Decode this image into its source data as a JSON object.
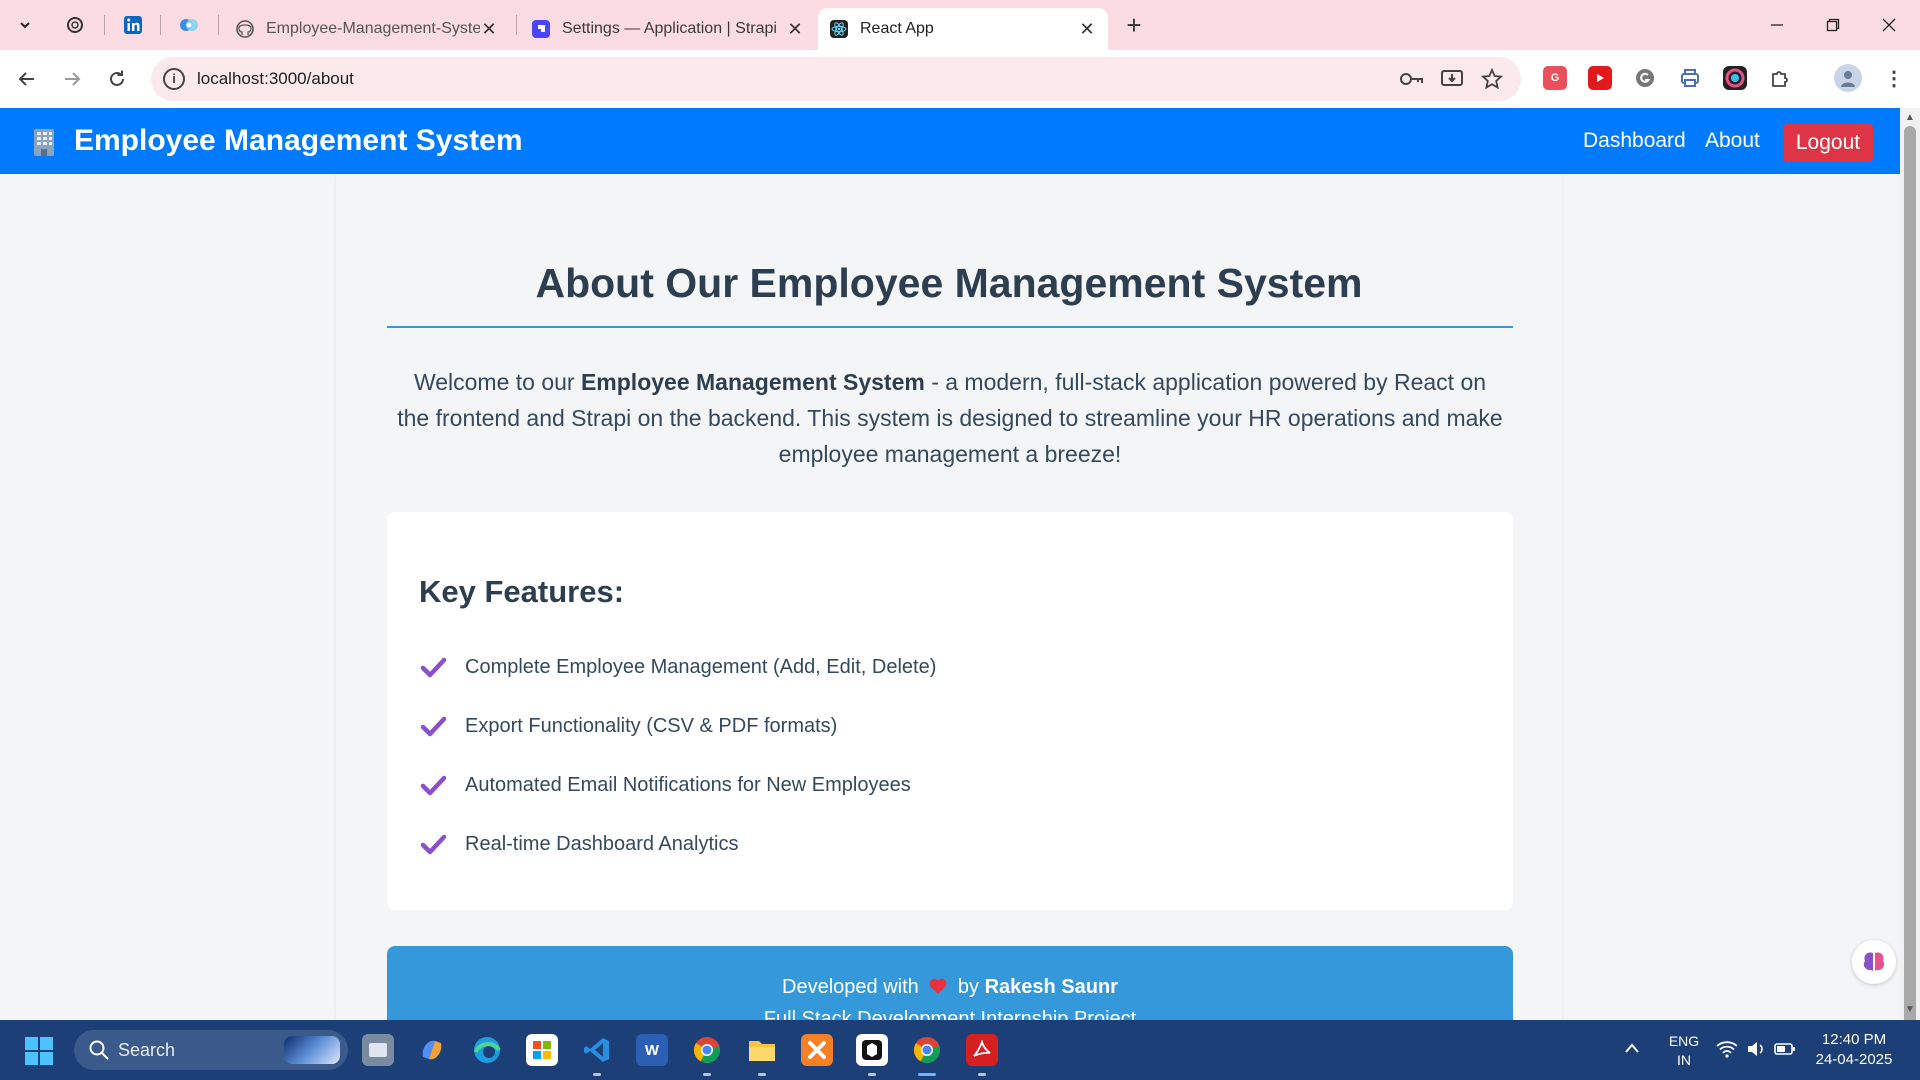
{
  "browser": {
    "tabs": [
      {
        "title": "Employee-Management-System",
        "active": false
      },
      {
        "title": "Settings — Application | Strapi",
        "active": false
      },
      {
        "title": "React App",
        "active": true
      }
    ],
    "url": "localhost:3000/about"
  },
  "navbar": {
    "brand": "Employee Management System",
    "links": [
      "Dashboard",
      "About"
    ],
    "logout_label": "Logout",
    "color": "#007bff",
    "logout_color": "#dc3545"
  },
  "about": {
    "title": "About Our Employee Management System",
    "intro_prefix": "Welcome to our ",
    "intro_bold": "Employee Management System",
    "intro_suffix": " - a modern, full-stack application powered by React on the frontend and Strapi on the backend. This system is designed to streamline your HR operations and make employee management a breeze!",
    "features_title": "Key Features:",
    "features": [
      "Complete Employee Management (Add, Edit, Delete)",
      "Export Functionality (CSV & PDF formats)",
      "Automated Email Notifications for New Employees",
      "Real-time Dashboard Analytics"
    ],
    "footer_prefix": "Developed with",
    "footer_by": "by",
    "footer_author": "Rakesh Saunr",
    "footer_line2": "Full Stack Development Internship Project",
    "accent_color": "#3498db",
    "check_color": "#8a4fc9"
  },
  "taskbar": {
    "search_label": "Search",
    "language": "ENG",
    "region": "IN",
    "time": "12:40 PM",
    "date": "24-04-2025"
  }
}
